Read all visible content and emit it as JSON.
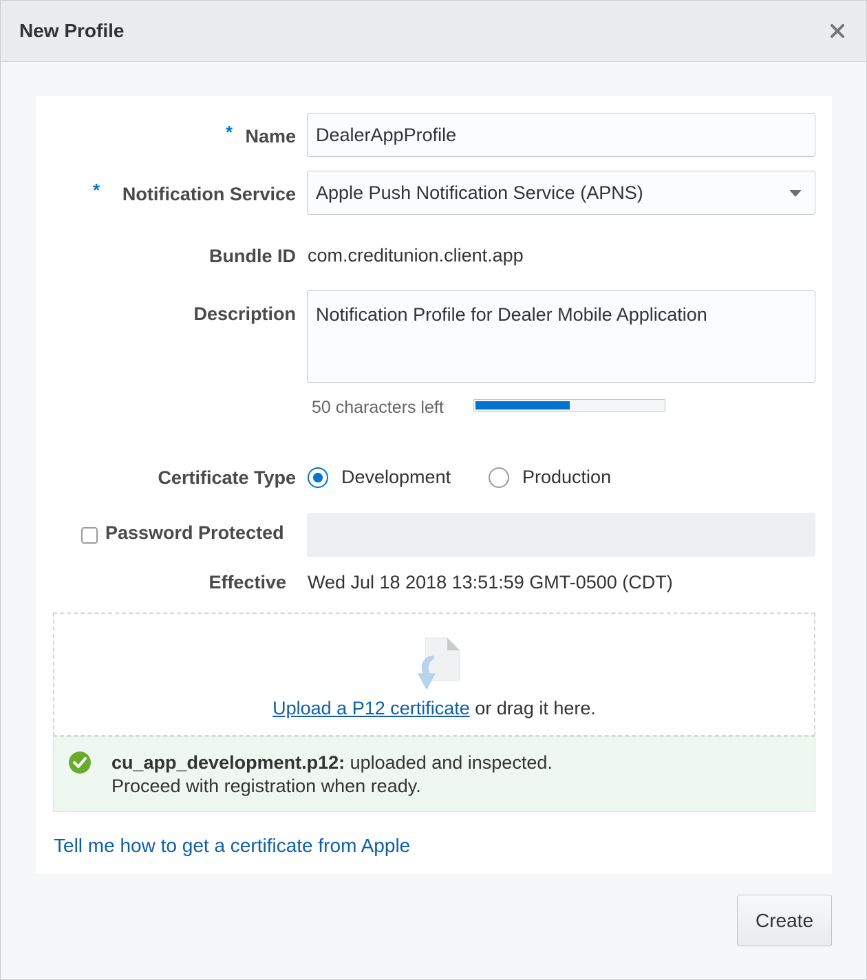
{
  "dialog": {
    "title": "New Profile",
    "close_icon": "close-icon"
  },
  "form": {
    "name": {
      "required_mark": "*",
      "label": "Name",
      "value": "DealerAppProfile"
    },
    "notification_service": {
      "required_mark": "*",
      "label": "Notification Service",
      "value": "Apple Push Notification Service (APNS)",
      "icon": "chevron-down-icon"
    },
    "bundle_id": {
      "label": "Bundle ID",
      "value": "com.creditunion.client.app"
    },
    "description": {
      "label": "Description",
      "value": "Notification Profile for Dealer Mobile Application",
      "counter_text": "50 characters left",
      "remaining_fraction": 0.5
    },
    "certificate_type": {
      "label": "Certificate Type",
      "options": [
        {
          "label": "Development",
          "selected": true
        },
        {
          "label": "Production",
          "selected": false
        }
      ]
    },
    "password_protected": {
      "label": "Password Protected",
      "checked": false
    },
    "effective": {
      "label": "Effective",
      "value": "Wed Jul 18 2018 13:51:59 GMT-0500 (CDT)"
    }
  },
  "upload": {
    "icon": "upload-file-icon",
    "link_text": "Upload a P12 certificate",
    "suffix_text": " or drag it here."
  },
  "status": {
    "icon": "check-circle-icon",
    "filename": "cu_app_development.p12:",
    "message": " uploaded and inspected.",
    "line2": "Proceed with registration when ready."
  },
  "help_link": "Tell me how to get a certificate from Apple",
  "buttons": {
    "create": "Create"
  },
  "colors": {
    "accent": "#0572ce",
    "link": "#0e5fa6",
    "success_bg": "#eef8f0",
    "success_icon": "#6aab2e"
  }
}
